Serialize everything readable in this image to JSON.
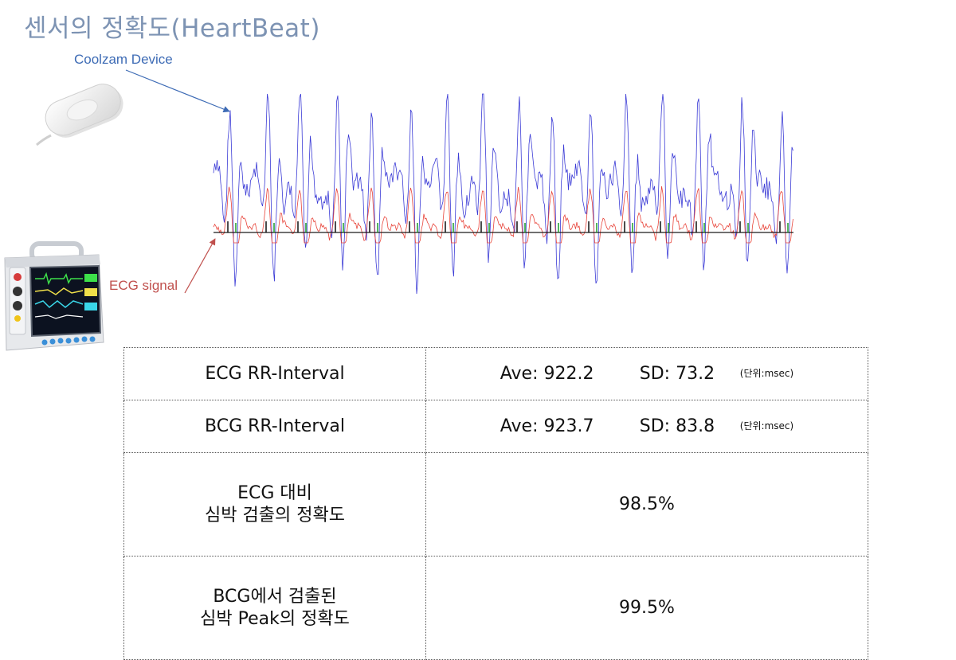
{
  "slide": {
    "title": "센서의 정확도(HeartBeat)"
  },
  "callouts": {
    "device": "Coolzam Device",
    "ecg": "ECG signal"
  },
  "colors": {
    "title": "#7d93b3",
    "bcg_signal": "#3b3bd6",
    "ecg_signal": "#e8443a",
    "baseline": "#1a1a1a",
    "peak_marker_green": "#1a9c2a",
    "peak_marker_black": "#111111"
  },
  "icons": {
    "device": "coolzam-device-image",
    "monitor": "patient-monitor-image"
  },
  "table": {
    "rows": [
      {
        "label": "ECG RR-Interval",
        "ave": "Ave: 922.2",
        "sd": "SD: 73.2",
        "unit": "(단위:msec)"
      },
      {
        "label": "BCG RR-Interval",
        "ave": "Ave: 923.7",
        "sd": "SD: 83.8",
        "unit": "(단위:msec)"
      },
      {
        "label_line1": "ECG 대비",
        "label_line2": "심박 검출의 정확도",
        "value": "98.5%"
      },
      {
        "label_line1": "BCG에서 검출된",
        "label_line2": "심박 Peak의 정확도",
        "value": "99.5%"
      }
    ]
  }
}
